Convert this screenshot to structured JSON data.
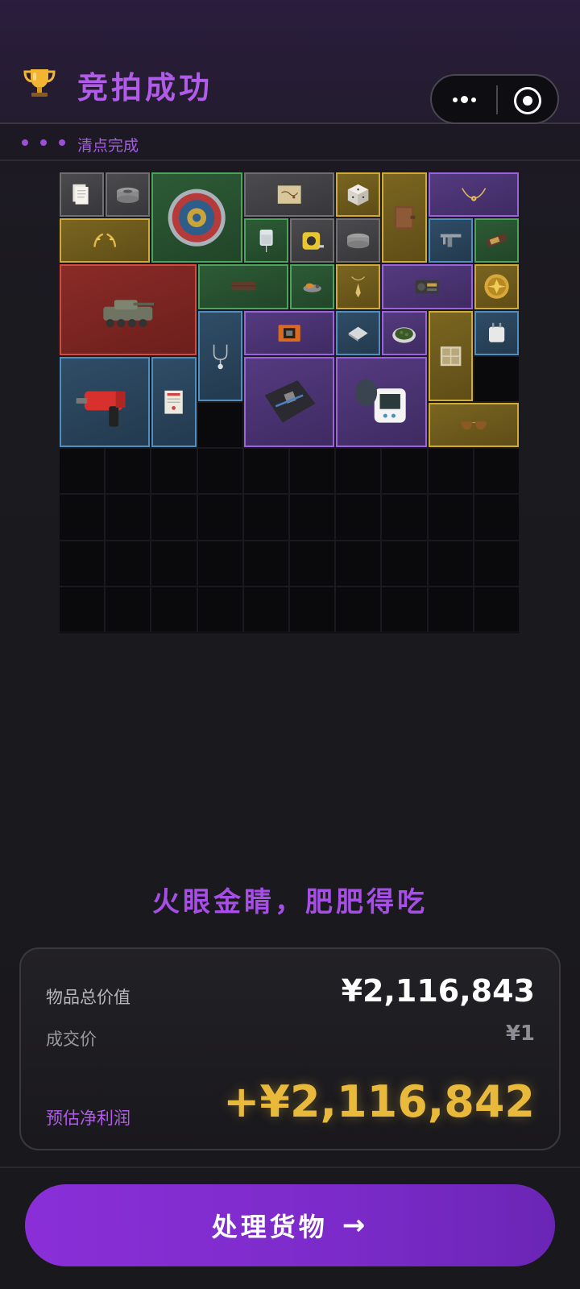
{
  "header": {
    "title": "竞拍成功",
    "status_text": "清点完成"
  },
  "inventory": {
    "cols": 10,
    "rows": 10,
    "items": [
      {
        "name": "documents",
        "rarity": "grey",
        "col": 0,
        "row": 0,
        "w": 1,
        "h": 1
      },
      {
        "name": "duct-tape",
        "rarity": "grey",
        "col": 1,
        "row": 0,
        "w": 1,
        "h": 1
      },
      {
        "name": "ornate-plate",
        "rarity": "green",
        "col": 2,
        "row": 0,
        "w": 2,
        "h": 2
      },
      {
        "name": "treasure-map",
        "rarity": "grey",
        "col": 4,
        "row": 0,
        "w": 2,
        "h": 1
      },
      {
        "name": "puzzle-cube",
        "rarity": "gold",
        "col": 6,
        "row": 0,
        "w": 1,
        "h": 1
      },
      {
        "name": "leather-journal",
        "rarity": "gold",
        "col": 7,
        "row": 0,
        "w": 1,
        "h": 2
      },
      {
        "name": "horned-necklace",
        "rarity": "purple",
        "col": 8,
        "row": 0,
        "w": 2,
        "h": 1
      },
      {
        "name": "laurel-wreath",
        "rarity": "gold",
        "col": 0,
        "row": 1,
        "w": 2,
        "h": 1
      },
      {
        "name": "iv-bag",
        "rarity": "green",
        "col": 4,
        "row": 1,
        "w": 1,
        "h": 1
      },
      {
        "name": "tape-measure",
        "rarity": "grey",
        "col": 5,
        "row": 1,
        "w": 1,
        "h": 1
      },
      {
        "name": "cloth-roll",
        "rarity": "grey",
        "col": 6,
        "row": 1,
        "w": 1,
        "h": 1
      },
      {
        "name": "caliper",
        "rarity": "blue",
        "col": 8,
        "row": 1,
        "w": 1,
        "h": 1
      },
      {
        "name": "energy-bar",
        "rarity": "green",
        "col": 9,
        "row": 1,
        "w": 1,
        "h": 1
      },
      {
        "name": "armored-vehicle",
        "rarity": "red",
        "col": 0,
        "row": 2,
        "w": 3,
        "h": 2
      },
      {
        "name": "wooden-plank",
        "rarity": "green",
        "col": 3,
        "row": 2,
        "w": 2,
        "h": 1
      },
      {
        "name": "toy-bird",
        "rarity": "green",
        "col": 5,
        "row": 2,
        "w": 1,
        "h": 1
      },
      {
        "name": "pendant",
        "rarity": "gold",
        "col": 6,
        "row": 2,
        "w": 1,
        "h": 1
      },
      {
        "name": "radio",
        "rarity": "purple",
        "col": 7,
        "row": 2,
        "w": 2,
        "h": 1
      },
      {
        "name": "gold-medallion",
        "rarity": "gold",
        "col": 9,
        "row": 2,
        "w": 1,
        "h": 1
      },
      {
        "name": "stethoscope",
        "rarity": "blue",
        "col": 3,
        "row": 3,
        "w": 1,
        "h": 2
      },
      {
        "name": "device-box",
        "rarity": "purple",
        "col": 4,
        "row": 3,
        "w": 2,
        "h": 1
      },
      {
        "name": "metal-plate",
        "rarity": "blue",
        "col": 6,
        "row": 3,
        "w": 1,
        "h": 1
      },
      {
        "name": "herb-dish",
        "rarity": "purple",
        "col": 7,
        "row": 3,
        "w": 1,
        "h": 1
      },
      {
        "name": "stamp-sheet",
        "rarity": "gold",
        "col": 8,
        "row": 3,
        "w": 1,
        "h": 2
      },
      {
        "name": "power-adapter",
        "rarity": "blue",
        "col": 9,
        "row": 3,
        "w": 1,
        "h": 1
      },
      {
        "name": "rotary-hammer",
        "rarity": "blue",
        "col": 0,
        "row": 4,
        "w": 2,
        "h": 2
      },
      {
        "name": "confidential-file",
        "rarity": "blue",
        "col": 2,
        "row": 4,
        "w": 1,
        "h": 2
      },
      {
        "name": "motherboard",
        "rarity": "purple",
        "col": 4,
        "row": 4,
        "w": 2,
        "h": 2
      },
      {
        "name": "blood-pressure-monitor",
        "rarity": "purple",
        "col": 6,
        "row": 4,
        "w": 2,
        "h": 2
      },
      {
        "name": "aviator-sunglasses",
        "rarity": "gold",
        "col": 8,
        "row": 5,
        "w": 2,
        "h": 1
      }
    ]
  },
  "slogan": "火眼金睛，肥肥得吃",
  "summary": {
    "total_label": "物品总价值",
    "total_value": "¥2,116,843",
    "deal_label": "成交价",
    "deal_value": "¥1",
    "profit_label": "预估净利润",
    "profit_value": "+¥2,116,842"
  },
  "action": {
    "label": "处理货物",
    "arrow": "→"
  },
  "colors": {
    "accent": "#a64ee6",
    "profit": "#e8b93a",
    "button": "#7b2bc9"
  }
}
